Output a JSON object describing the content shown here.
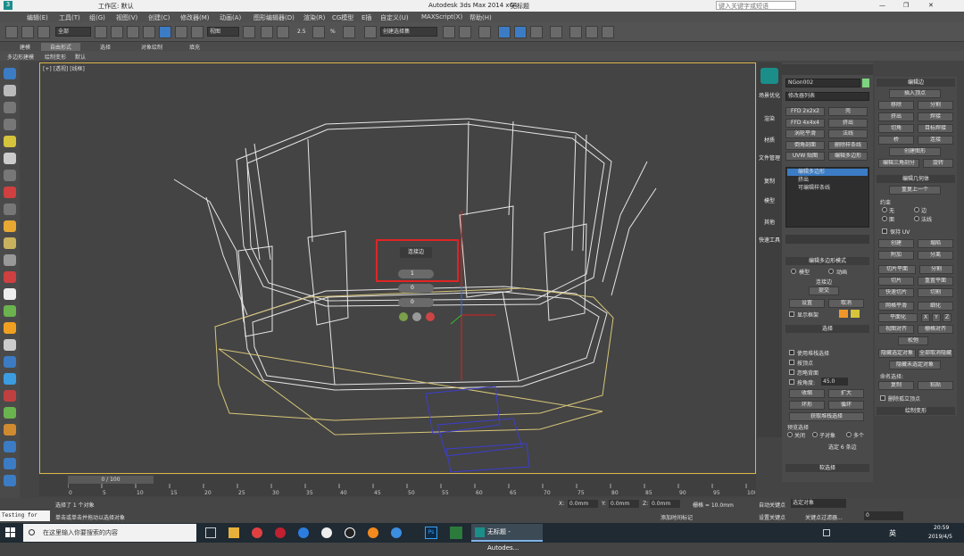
{
  "window": {
    "workspace": "工作区: 默认",
    "title": "Autodesk 3ds Max  2014 x64",
    "doc": "无标题",
    "search_placeholder": "键入关键字或短语"
  },
  "menu": [
    "编辑(E)",
    "工具(T)",
    "组(G)",
    "视图(V)",
    "创建(C)",
    "修改器(M)",
    "动画(A)",
    "图形编辑器(D)",
    "渲染(R)",
    "CG模型",
    "E插",
    "自定义(U)",
    "MAXScript(X)",
    "帮助(H)"
  ],
  "toolbar": {
    "filter": "全部",
    "refcoord": "视图",
    "selset": "创建选择集",
    "angle": "2.5",
    "pct": "%"
  },
  "ribbon": {
    "tabs": [
      "建模",
      "自由形式",
      "选择",
      "对象绘制",
      "填充"
    ],
    "sub": [
      "多边形建模",
      "绘制变形",
      "默认"
    ]
  },
  "viewport": {
    "label": "[+] [透视] [线框]",
    "caddy": {
      "title": "连接边",
      "v1": "1",
      "v2": "0",
      "v3": "0"
    }
  },
  "cmdtabs": [
    "场景优化",
    "渲染",
    "材质",
    "文件管理",
    "复制",
    "模型",
    "其他",
    "快速工具"
  ],
  "modify": {
    "object_name": "NGon002",
    "modlist": "修改器列表",
    "buttons": [
      "FFD 2x2x2",
      "壳",
      "FFD 4x4x4",
      "挤出",
      "涡轮平滑",
      "法线",
      "倒角剖面",
      "删除样条线",
      "UVW 贴图",
      "编辑多边形"
    ],
    "stack": [
      "编辑多边形",
      "挤出",
      "可编辑样条线"
    ],
    "mode_title": "编辑多边形模式",
    "mode_model": "模型",
    "mode_anim": "动画",
    "mode_op": "连接边",
    "commit": "提交",
    "settings": "设置",
    "cancel": "取消",
    "show_cage": "显示框架",
    "sel_title": "选择",
    "sel_opts": [
      "使用堆栈选择",
      "按顶点",
      "忽略背面",
      "按角度:"
    ],
    "angle_val": "45.0",
    "shrink": "收缩",
    "grow": "扩大",
    "ring": "环形",
    "loop": "循环",
    "get_stack": "获取堆栈选择",
    "preview": "预览选择",
    "off": "关闭",
    "subobj": "子对象",
    "multi": "多个",
    "sel_count": "选定 6 条边",
    "soft": "软选择"
  },
  "edit": {
    "title": "编辑边",
    "insert": "插入顶点",
    "remove": "移除",
    "split": "分割",
    "extrude": "挤出",
    "weld": "焊接",
    "chamfer": "切角",
    "target_weld": "目标焊接",
    "bridge": "桥",
    "connect": "连接",
    "create_shape": "创建图形",
    "edit_tri": "编辑三角剖分",
    "rotate": "旋转",
    "geo_title": "编辑几何体",
    "repeat": "重复上一个",
    "constraint": "约束",
    "c_none": "无",
    "c_edge": "边",
    "c_face": "面",
    "c_normal": "法线",
    "keep_uv": "保持 UV",
    "create": "创建",
    "collapse": "塌陷",
    "attach": "附加",
    "detach": "分离",
    "slice_plane": "切片平面",
    "split2": "分割",
    "slice": "切片",
    "reset_plane": "重置平面",
    "quickslice": "快速切片",
    "cut": "切割",
    "msmooth": "网格平滑",
    "tess": "细化",
    "planar": "平面化",
    "x": "X",
    "y": "Y",
    "z": "Z",
    "view_align": "视图对齐",
    "grid_align": "栅格对齐",
    "relax": "松弛",
    "hide_sel": "隐藏选定对象",
    "unhide": "全部取消隐藏",
    "hide_unsel": "隐藏未选定对象",
    "named": "命名选择:",
    "copy": "复制",
    "paste": "粘贴",
    "del_iso": "删除孤立顶点",
    "paint": "绘制变形"
  },
  "timeline": {
    "frame": "0 / 100",
    "ticks": [
      "0",
      "5",
      "10",
      "15",
      "20",
      "25",
      "30",
      "35",
      "40",
      "45",
      "50",
      "55",
      "60",
      "65",
      "70",
      "75",
      "80",
      "85",
      "90",
      "95",
      "100"
    ]
  },
  "status": {
    "msg1": "选择了 1 个对象",
    "msg2": "单击或单击并拖动以选择对象",
    "x": "0.0mm",
    "y": "0.0mm",
    "z": "0.0mm",
    "grid": "栅格 = 10.0mm",
    "autokey": "自动关键点",
    "setkey": "设置关键点",
    "selobj": "选定对象",
    "keyfilter": "关键点过滤器...",
    "addtime": "添加时间标记",
    "frame": "0",
    "test": "Testing for ALL"
  },
  "taskbar": {
    "search": "在这里输入你要搜索的内容",
    "app": "无标题 - Autodes...",
    "time": "20:59",
    "date": "2019/4/5",
    "ime": "英"
  }
}
